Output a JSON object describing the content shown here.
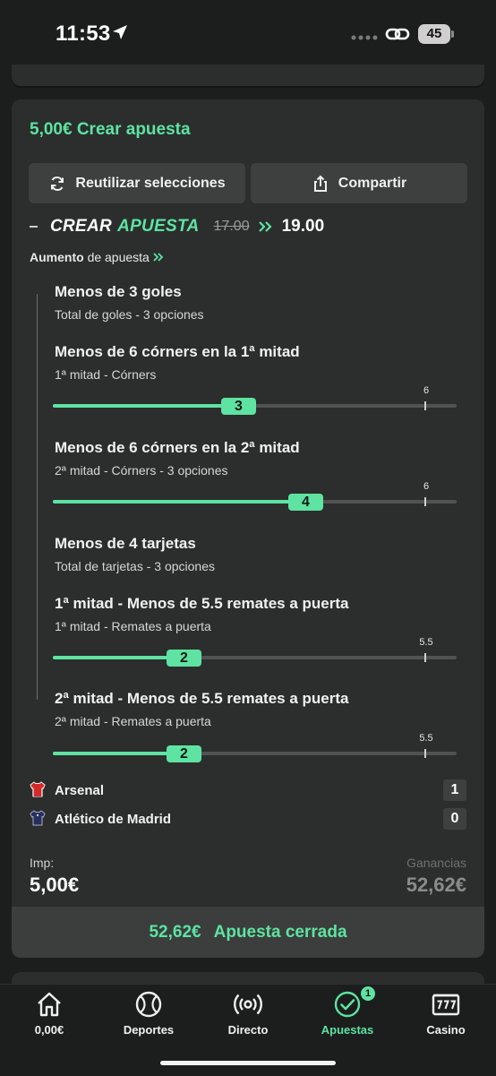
{
  "status": {
    "time": "11:53",
    "battery": "45"
  },
  "header": {
    "amount": "5,00€",
    "title": "Crear apuesta"
  },
  "buttons": {
    "reuse": "Reutilizar selecciones",
    "share": "Compartir"
  },
  "betbuilder": {
    "word1": "CREAR",
    "word2": "APUESTA",
    "old_odds": "17.00",
    "new_odds": "19.00"
  },
  "boost": {
    "bold": "Aumento",
    "rest": "de apuesta"
  },
  "legs": [
    {
      "title": "Menos de 3 goles",
      "subtitle": "Total de goles - 3 opciones"
    },
    {
      "title": "Menos de 6 córners en la 1ª mitad",
      "subtitle": "1ª mitad - Córners",
      "slider": {
        "value": "3",
        "max": "6",
        "fraction": 0.5
      }
    },
    {
      "title": "Menos de 6 córners en la 2ª mitad",
      "subtitle": "2ª mitad - Córners - 3 opciones",
      "slider": {
        "value": "4",
        "max": "6",
        "fraction": 0.667
      }
    },
    {
      "title": "Menos de 4 tarjetas",
      "subtitle": "Total de tarjetas - 3 opciones"
    },
    {
      "title": "1ª mitad - Menos de 5.5 remates a puerta",
      "subtitle": "1ª mitad - Remates a puerta",
      "slider": {
        "value": "2",
        "max": "5.5",
        "fraction": 0.346
      }
    },
    {
      "title": "2ª mitad - Menos de 5.5 remates a puerta",
      "subtitle": "2ª mitad - Remates a puerta",
      "slider": {
        "value": "2",
        "max": "5.5",
        "fraction": 0.346
      }
    }
  ],
  "teams": [
    {
      "name": "Arsenal",
      "score": "1",
      "color": "#d42a2a"
    },
    {
      "name": "Atlético de Madrid",
      "score": "0",
      "color": "#26305e"
    }
  ],
  "stake": {
    "label": "Imp:",
    "value": "5,00€"
  },
  "winnings": {
    "label": "Ganancias",
    "value": "52,62€"
  },
  "closed": {
    "amount": "52,62€",
    "label": "Apuesta cerrada"
  },
  "tabs": [
    {
      "label": "0,00€",
      "icon": "home-icon"
    },
    {
      "label": "Deportes",
      "icon": "ball-icon"
    },
    {
      "label": "Directo",
      "icon": "live-icon"
    },
    {
      "label": "Apuestas",
      "icon": "bets-check-icon",
      "badge": "1"
    },
    {
      "label": "Casino",
      "icon": "slot-icon"
    }
  ],
  "colors": {
    "accent": "#5ee3a2",
    "card": "#2b2e2d",
    "background": "#1c1e1d"
  }
}
